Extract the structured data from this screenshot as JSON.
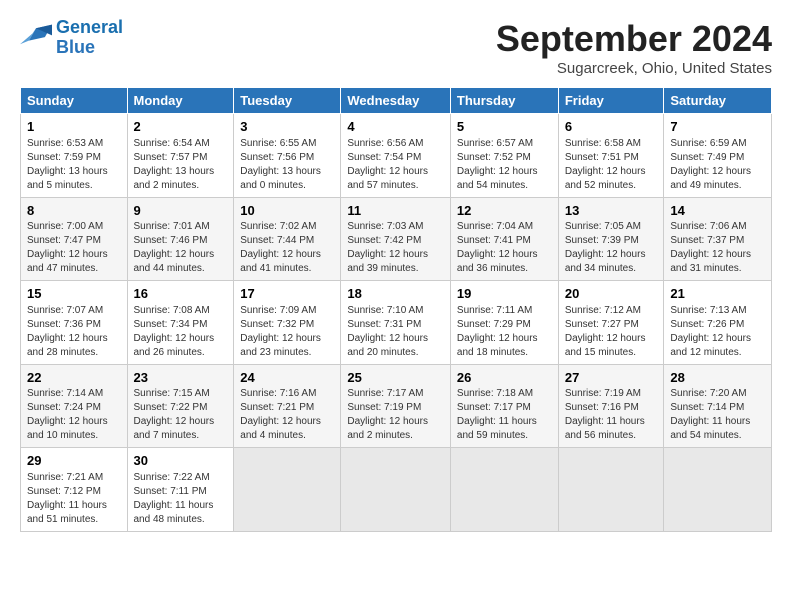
{
  "logo": {
    "line1": "General",
    "line2": "Blue"
  },
  "title": "September 2024",
  "subtitle": "Sugarcreek, Ohio, United States",
  "days_of_week": [
    "Sunday",
    "Monday",
    "Tuesday",
    "Wednesday",
    "Thursday",
    "Friday",
    "Saturday"
  ],
  "weeks": [
    [
      {
        "day": "1",
        "info": "Sunrise: 6:53 AM\nSunset: 7:59 PM\nDaylight: 13 hours\nand 5 minutes."
      },
      {
        "day": "2",
        "info": "Sunrise: 6:54 AM\nSunset: 7:57 PM\nDaylight: 13 hours\nand 2 minutes."
      },
      {
        "day": "3",
        "info": "Sunrise: 6:55 AM\nSunset: 7:56 PM\nDaylight: 13 hours\nand 0 minutes."
      },
      {
        "day": "4",
        "info": "Sunrise: 6:56 AM\nSunset: 7:54 PM\nDaylight: 12 hours\nand 57 minutes."
      },
      {
        "day": "5",
        "info": "Sunrise: 6:57 AM\nSunset: 7:52 PM\nDaylight: 12 hours\nand 54 minutes."
      },
      {
        "day": "6",
        "info": "Sunrise: 6:58 AM\nSunset: 7:51 PM\nDaylight: 12 hours\nand 52 minutes."
      },
      {
        "day": "7",
        "info": "Sunrise: 6:59 AM\nSunset: 7:49 PM\nDaylight: 12 hours\nand 49 minutes."
      }
    ],
    [
      {
        "day": "8",
        "info": "Sunrise: 7:00 AM\nSunset: 7:47 PM\nDaylight: 12 hours\nand 47 minutes."
      },
      {
        "day": "9",
        "info": "Sunrise: 7:01 AM\nSunset: 7:46 PM\nDaylight: 12 hours\nand 44 minutes."
      },
      {
        "day": "10",
        "info": "Sunrise: 7:02 AM\nSunset: 7:44 PM\nDaylight: 12 hours\nand 41 minutes."
      },
      {
        "day": "11",
        "info": "Sunrise: 7:03 AM\nSunset: 7:42 PM\nDaylight: 12 hours\nand 39 minutes."
      },
      {
        "day": "12",
        "info": "Sunrise: 7:04 AM\nSunset: 7:41 PM\nDaylight: 12 hours\nand 36 minutes."
      },
      {
        "day": "13",
        "info": "Sunrise: 7:05 AM\nSunset: 7:39 PM\nDaylight: 12 hours\nand 34 minutes."
      },
      {
        "day": "14",
        "info": "Sunrise: 7:06 AM\nSunset: 7:37 PM\nDaylight: 12 hours\nand 31 minutes."
      }
    ],
    [
      {
        "day": "15",
        "info": "Sunrise: 7:07 AM\nSunset: 7:36 PM\nDaylight: 12 hours\nand 28 minutes."
      },
      {
        "day": "16",
        "info": "Sunrise: 7:08 AM\nSunset: 7:34 PM\nDaylight: 12 hours\nand 26 minutes."
      },
      {
        "day": "17",
        "info": "Sunrise: 7:09 AM\nSunset: 7:32 PM\nDaylight: 12 hours\nand 23 minutes."
      },
      {
        "day": "18",
        "info": "Sunrise: 7:10 AM\nSunset: 7:31 PM\nDaylight: 12 hours\nand 20 minutes."
      },
      {
        "day": "19",
        "info": "Sunrise: 7:11 AM\nSunset: 7:29 PM\nDaylight: 12 hours\nand 18 minutes."
      },
      {
        "day": "20",
        "info": "Sunrise: 7:12 AM\nSunset: 7:27 PM\nDaylight: 12 hours\nand 15 minutes."
      },
      {
        "day": "21",
        "info": "Sunrise: 7:13 AM\nSunset: 7:26 PM\nDaylight: 12 hours\nand 12 minutes."
      }
    ],
    [
      {
        "day": "22",
        "info": "Sunrise: 7:14 AM\nSunset: 7:24 PM\nDaylight: 12 hours\nand 10 minutes."
      },
      {
        "day": "23",
        "info": "Sunrise: 7:15 AM\nSunset: 7:22 PM\nDaylight: 12 hours\nand 7 minutes."
      },
      {
        "day": "24",
        "info": "Sunrise: 7:16 AM\nSunset: 7:21 PM\nDaylight: 12 hours\nand 4 minutes."
      },
      {
        "day": "25",
        "info": "Sunrise: 7:17 AM\nSunset: 7:19 PM\nDaylight: 12 hours\nand 2 minutes."
      },
      {
        "day": "26",
        "info": "Sunrise: 7:18 AM\nSunset: 7:17 PM\nDaylight: 11 hours\nand 59 minutes."
      },
      {
        "day": "27",
        "info": "Sunrise: 7:19 AM\nSunset: 7:16 PM\nDaylight: 11 hours\nand 56 minutes."
      },
      {
        "day": "28",
        "info": "Sunrise: 7:20 AM\nSunset: 7:14 PM\nDaylight: 11 hours\nand 54 minutes."
      }
    ],
    [
      {
        "day": "29",
        "info": "Sunrise: 7:21 AM\nSunset: 7:12 PM\nDaylight: 11 hours\nand 51 minutes."
      },
      {
        "day": "30",
        "info": "Sunrise: 7:22 AM\nSunset: 7:11 PM\nDaylight: 11 hours\nand 48 minutes."
      },
      {
        "day": "",
        "info": ""
      },
      {
        "day": "",
        "info": ""
      },
      {
        "day": "",
        "info": ""
      },
      {
        "day": "",
        "info": ""
      },
      {
        "day": "",
        "info": ""
      }
    ]
  ]
}
